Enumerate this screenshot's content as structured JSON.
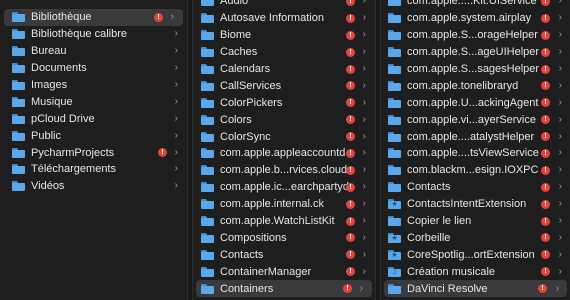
{
  "column1": {
    "items": [
      {
        "label": "Bibliothèque",
        "selected": true,
        "badge": true
      },
      {
        "label": "Bibliothèque calibre",
        "badge": false
      },
      {
        "label": "Bureau",
        "badge": false
      },
      {
        "label": "Documents",
        "badge": false
      },
      {
        "label": "Images",
        "badge": false
      },
      {
        "label": "Musique",
        "badge": false
      },
      {
        "label": "pCloud Drive",
        "badge": false
      },
      {
        "label": "Public",
        "badge": false
      },
      {
        "label": "PycharmProjects",
        "badge": true
      },
      {
        "label": "Téléchargements",
        "badge": false
      },
      {
        "label": "Vidéos",
        "badge": false
      }
    ]
  },
  "column2": {
    "items": [
      {
        "label": "Audio",
        "badge": true
      },
      {
        "label": "Autosave Information",
        "badge": true
      },
      {
        "label": "Biome",
        "badge": true
      },
      {
        "label": "Caches",
        "badge": true
      },
      {
        "label": "Calendars",
        "badge": true
      },
      {
        "label": "CallServices",
        "badge": true
      },
      {
        "label": "ColorPickers",
        "badge": true
      },
      {
        "label": "Colors",
        "badge": true
      },
      {
        "label": "ColorSync",
        "badge": true
      },
      {
        "label": "com.apple.appleaccountd",
        "badge": true
      },
      {
        "label": "com.apple.b...rvices.cloud",
        "badge": true
      },
      {
        "label": "com.apple.ic...earchpartyd",
        "badge": true
      },
      {
        "label": "com.apple.internal.ck",
        "badge": true
      },
      {
        "label": "com.apple.WatchListKit",
        "badge": true
      },
      {
        "label": "Compositions",
        "badge": true
      },
      {
        "label": "Contacts",
        "badge": true
      },
      {
        "label": "ContainerManager",
        "badge": true
      },
      {
        "label": "Containers",
        "badge": true,
        "selected": true
      }
    ]
  },
  "column3": {
    "items": [
      {
        "label": "com.apple.....Kit.UIService",
        "badge": true
      },
      {
        "label": "com.apple.system.airplay",
        "badge": true
      },
      {
        "label": "com.apple.S...orageHelper",
        "badge": true
      },
      {
        "label": "com.apple.S...ageUIHelper",
        "badge": true
      },
      {
        "label": "com.apple.S...sagesHelper",
        "badge": true
      },
      {
        "label": "com.apple.tonelibraryd",
        "badge": true
      },
      {
        "label": "com.apple.U...ackingAgent",
        "badge": true
      },
      {
        "label": "com.apple.vi...ayerService",
        "badge": true
      },
      {
        "label": "com.apple....atalystHelper",
        "badge": true
      },
      {
        "label": "com.apple....tsViewService",
        "badge": true
      },
      {
        "label": "com.blackm...esign.IOXPC",
        "badge": true
      },
      {
        "label": "Contacts",
        "badge": true,
        "glyph": ""
      },
      {
        "label": "ContactsIntentExtension",
        "badge": true,
        "glyph": "★"
      },
      {
        "label": "Copier le lien",
        "badge": true,
        "glyph": ""
      },
      {
        "label": "Corbeille",
        "badge": true,
        "glyph": "★"
      },
      {
        "label": "CoreSpotlig...ortExtension",
        "badge": true,
        "glyph": "★"
      },
      {
        "label": "Création musicale",
        "badge": true,
        "glyph": "♫"
      },
      {
        "label": "DaVinci Resolve",
        "badge": true,
        "selected": true
      }
    ]
  },
  "badge_symbol": "!",
  "chevron_symbol": "›",
  "colors": {
    "background": "#1e1e1e",
    "selection": "#3a3a3c",
    "folder": "#5aa8ea",
    "badge": "#e4453a"
  }
}
